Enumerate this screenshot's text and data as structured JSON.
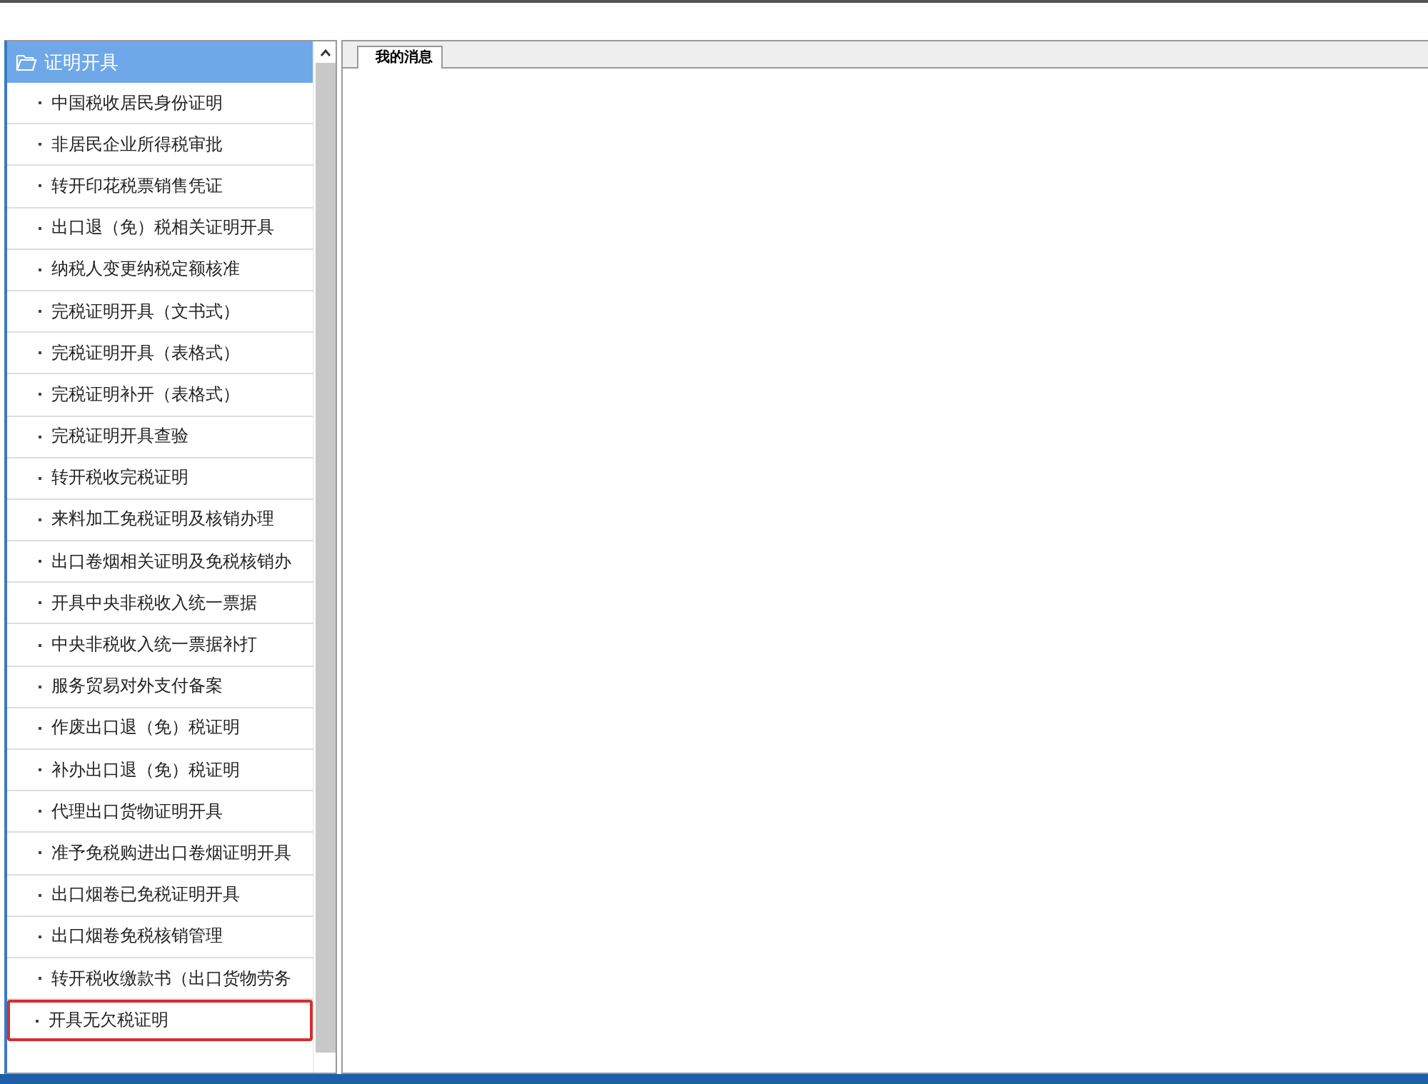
{
  "sidebar": {
    "title": "证明开具",
    "items": [
      {
        "label": "中国税收居民身份证明",
        "selected": false
      },
      {
        "label": "非居民企业所得税审批",
        "selected": false
      },
      {
        "label": "转开印花税票销售凭证",
        "selected": false
      },
      {
        "label": "出口退（免）税相关证明开具",
        "selected": false
      },
      {
        "label": "纳税人变更纳税定额核准",
        "selected": false
      },
      {
        "label": "完税证明开具（文书式）",
        "selected": false
      },
      {
        "label": "完税证明开具（表格式）",
        "selected": false
      },
      {
        "label": "完税证明补开（表格式）",
        "selected": false
      },
      {
        "label": "完税证明开具查验",
        "selected": false
      },
      {
        "label": "转开税收完税证明",
        "selected": false
      },
      {
        "label": "来料加工免税证明及核销办理",
        "selected": false
      },
      {
        "label": "出口卷烟相关证明及免税核销办",
        "selected": false
      },
      {
        "label": "开具中央非税收入统一票据",
        "selected": false
      },
      {
        "label": "中央非税收入统一票据补打",
        "selected": false
      },
      {
        "label": "服务贸易对外支付备案",
        "selected": false
      },
      {
        "label": "作废出口退（免）税证明",
        "selected": false
      },
      {
        "label": "补办出口退（免）税证明",
        "selected": false
      },
      {
        "label": "代理出口货物证明开具",
        "selected": false
      },
      {
        "label": "准予免税购进出口卷烟证明开具",
        "selected": false
      },
      {
        "label": "出口烟卷已免税证明开具",
        "selected": false
      },
      {
        "label": "出口烟卷免税核销管理",
        "selected": false
      },
      {
        "label": "转开税收缴款书（出口货物劳务",
        "selected": false
      },
      {
        "label": "开具无欠税证明",
        "selected": true
      }
    ]
  },
  "tabs": [
    {
      "label": "我的消息",
      "selected": true
    }
  ]
}
